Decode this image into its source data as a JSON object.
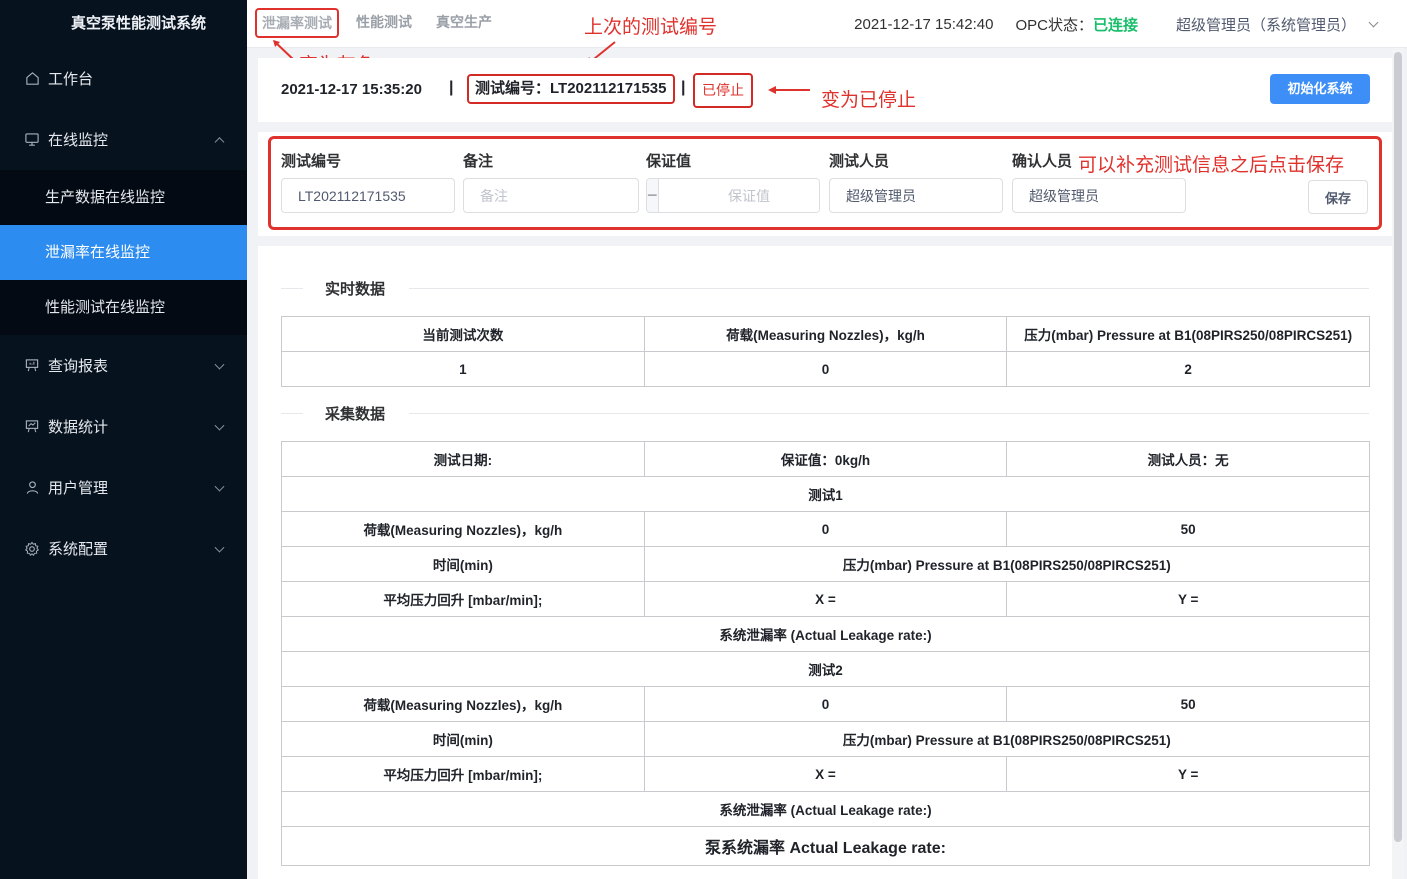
{
  "app": {
    "title": "真空泵性能测试系统"
  },
  "sidebar": {
    "items": [
      {
        "label": "工作台",
        "icon": "home-icon"
      },
      {
        "label": "在线监控",
        "icon": "monitor-icon",
        "expanded": true,
        "children": [
          {
            "label": "生产数据在线监控",
            "active": false
          },
          {
            "label": "泄漏率在线监控",
            "active": true
          },
          {
            "label": "性能测试在线监控",
            "active": false
          }
        ]
      },
      {
        "label": "查询报表",
        "icon": "report-board-icon"
      },
      {
        "label": "数据统计",
        "icon": "chart-board-icon"
      },
      {
        "label": "用户管理",
        "icon": "user-icon"
      },
      {
        "label": "系统配置",
        "icon": "gear-icon"
      }
    ]
  },
  "header": {
    "tabs": [
      {
        "label": "泄漏率测试"
      },
      {
        "label": "性能测试"
      },
      {
        "label": "真空生产"
      }
    ],
    "datetime": "2021-12-17 15:42:40",
    "opc_label": "OPC状态：",
    "opc_status": "已连接",
    "opc_status_color": "#19be6b",
    "user": "超级管理员（系统管理员）"
  },
  "status": {
    "start_time": "2021-12-17 15:35:20",
    "separator": "|",
    "test_number_text": "测试编号：LT202112171535",
    "state": "已停止",
    "init_button": "初始化系统"
  },
  "form": {
    "test_number": {
      "label": "测试编号",
      "value": "LT202112171535"
    },
    "remark": {
      "label": "备注",
      "placeholder": "备注",
      "value": ""
    },
    "guarantee": {
      "label": "保证值",
      "placeholder": "保证值",
      "value": "",
      "minus": "−",
      "plus": "+"
    },
    "tester": {
      "label": "测试人员",
      "value": "超级管理员"
    },
    "confirmer": {
      "label": "确认人员",
      "value": "超级管理员"
    },
    "save_button": "保存"
  },
  "annotations": {
    "gray_tab": "变为灰色",
    "last_test_number": "上次的测试编号",
    "stopped": "变为已停止",
    "save_hint": "可以补充测试信息之后点击保存",
    "color": "#e0322d"
  },
  "realtime": {
    "title": "实时数据",
    "headers": [
      "当前测试次数",
      "荷载(Measuring Nozzles)，kg/h",
      "压力(mbar) Pressure at B1(08PIRS250/08PIRCS251)"
    ],
    "values": [
      "1",
      "0",
      "2"
    ]
  },
  "collected": {
    "title": "采集数据",
    "info": [
      "测试日期:",
      "保证值：0kg/h",
      "测试人员：无"
    ],
    "tests": [
      {
        "title": "测试1",
        "load_label": "荷载(Measuring Nozzles)，kg/h",
        "load_values": [
          "0",
          "50"
        ],
        "time_label": "时间(min)",
        "pressure_label": "压力(mbar) Pressure at B1(08PIRS250/08PIRCS251)",
        "avg_label": "平均压力回升 [mbar/min];",
        "x_label": "X =",
        "y_label": "Y =",
        "leak_rate": "系统泄漏率 (Actual Leakage rate:)"
      },
      {
        "title": "测试2",
        "load_label": "荷载(Measuring Nozzles)，kg/h",
        "load_values": [
          "0",
          "50"
        ],
        "time_label": "时间(min)",
        "pressure_label": "压力(mbar) Pressure at B1(08PIRS250/08PIRCS251)",
        "avg_label": "平均压力回升 [mbar/min];",
        "x_label": "X =",
        "y_label": "Y =",
        "leak_rate": "系统泄漏率 (Actual Leakage rate:)"
      }
    ],
    "pump_leak_rate": "泵系统漏率 Actual Leakage rate:"
  }
}
